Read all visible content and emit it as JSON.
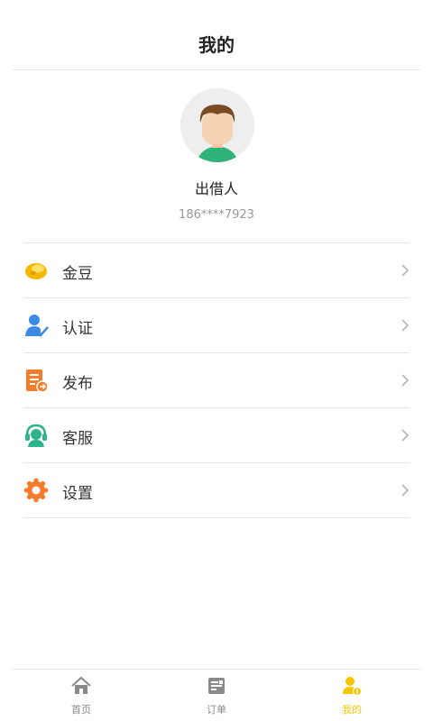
{
  "header": {
    "title": "我的"
  },
  "profile": {
    "name": "出借人",
    "phone": "186****7923"
  },
  "menu": {
    "items": [
      {
        "label": "金豆",
        "icon": "gold-bean-icon"
      },
      {
        "label": "认证",
        "icon": "verify-user-icon"
      },
      {
        "label": "发布",
        "icon": "publish-icon"
      },
      {
        "label": "客服",
        "icon": "customer-service-icon"
      },
      {
        "label": "设置",
        "icon": "settings-gear-icon"
      }
    ]
  },
  "tabbar": {
    "items": [
      {
        "label": "首页",
        "icon": "home-icon",
        "active": false
      },
      {
        "label": "订单",
        "icon": "order-icon",
        "active": false
      },
      {
        "label": "我的",
        "icon": "profile-icon",
        "active": true
      }
    ]
  },
  "colors": {
    "accent": "#f5c500",
    "gold": "#f5b800",
    "blue": "#3b8ae6",
    "orange": "#f57c2a",
    "green": "#2fb38a"
  }
}
